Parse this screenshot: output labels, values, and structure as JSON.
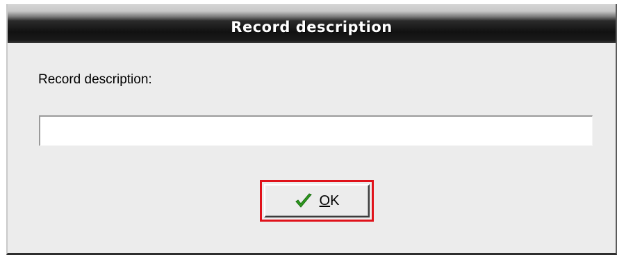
{
  "dialog": {
    "title": "Record description",
    "label": "Record description:",
    "input_value": "",
    "ok_button": {
      "mnemonic": "O",
      "rest": "K",
      "icon": "checkmark-icon",
      "icon_color": "#2e9a1f"
    },
    "highlight_color": "#e0121a"
  }
}
